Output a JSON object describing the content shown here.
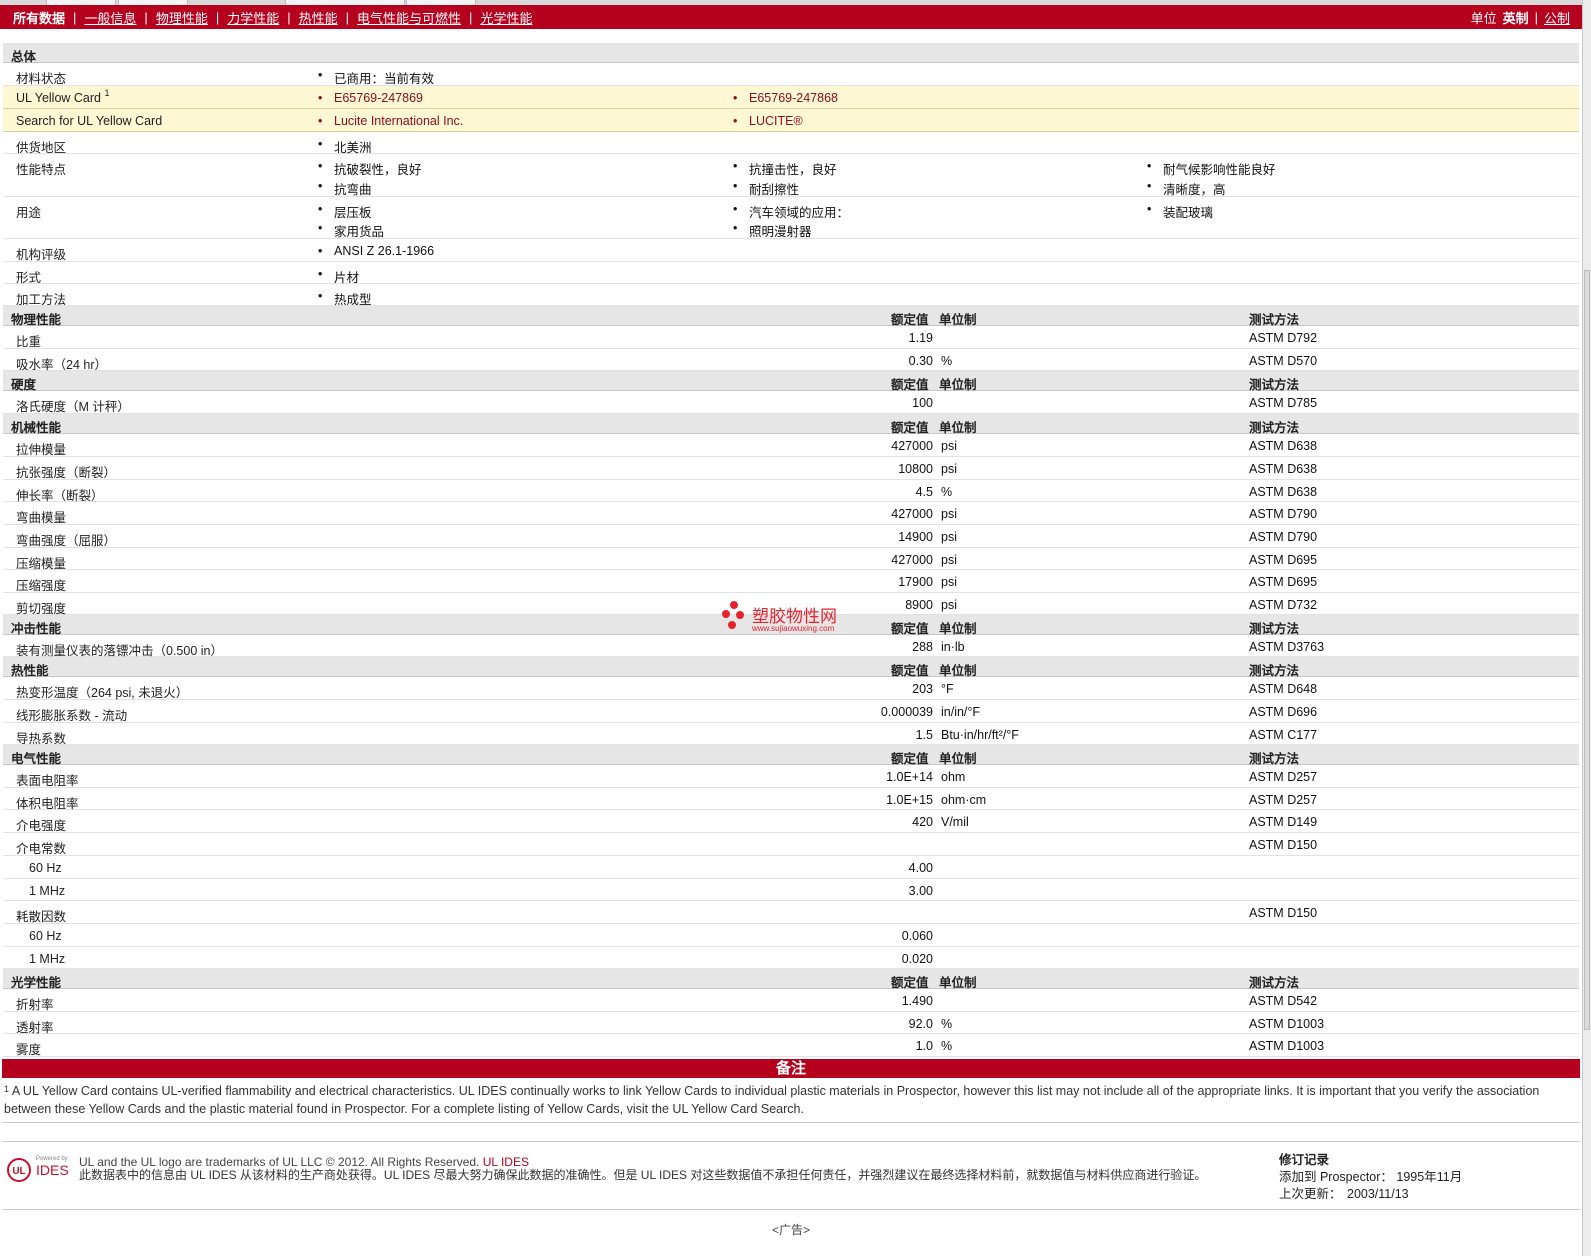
{
  "nav": {
    "items": [
      {
        "label": "所有数据",
        "active": true
      },
      {
        "label": "一般信息"
      },
      {
        "label": "物理性能"
      },
      {
        "label": "力学性能"
      },
      {
        "label": "热性能"
      },
      {
        "label": "电气性能与可燃性"
      },
      {
        "label": "光学性能"
      }
    ],
    "units_label": "单位",
    "unit_english": "英制",
    "unit_separator": "|",
    "unit_metric": "公制"
  },
  "col_headers": {
    "value": "额定值",
    "unit": "单位制",
    "method": "测试方法"
  },
  "general": {
    "title": "总体",
    "material_status": {
      "label": "材料状态",
      "values": [
        "已商用：当前有效"
      ]
    },
    "yellow_card": {
      "label": "UL Yellow Card",
      "sup": "1",
      "values": [
        "E65769-247869",
        "E65769-247868"
      ]
    },
    "search_yellow": {
      "label": "Search for UL Yellow Card",
      "values": [
        "Lucite International Inc.",
        "LUCITE®"
      ]
    },
    "supply": {
      "label": "供货地区",
      "values": [
        "北美洲"
      ]
    },
    "features": {
      "label": "性能特点",
      "values": [
        "抗破裂性，良好",
        "抗撞击性，良好",
        "耐气候影响性能良好",
        "抗弯曲",
        "耐刮擦性",
        "清晰度，高"
      ]
    },
    "uses": {
      "label": "用途",
      "values": [
        "层压板",
        "汽车领域的应用：",
        "装配玻璃",
        "家用货品",
        "照明漫射器"
      ]
    },
    "rating": {
      "label": "机构评级",
      "values": [
        "ANSI Z 26.1-1966"
      ]
    },
    "form": {
      "label": "形式",
      "values": [
        "片材"
      ]
    },
    "processing": {
      "label": "加工方法",
      "values": [
        "热成型"
      ]
    }
  },
  "physical": {
    "title": "物理性能",
    "rows": [
      {
        "label": "比重",
        "value": "1.19",
        "unit": "",
        "method": "ASTM D792"
      },
      {
        "label": "吸水率（24 hr）",
        "value": "0.30",
        "unit": "%",
        "method": "ASTM D570"
      }
    ]
  },
  "hardness": {
    "title": "硬度",
    "rows": [
      {
        "label": "洛氏硬度（M 计秤）",
        "value": "100",
        "unit": "",
        "method": "ASTM D785"
      }
    ]
  },
  "mechanical": {
    "title": "机械性能",
    "rows": [
      {
        "label": "拉伸模量",
        "value": "427000",
        "unit": "psi",
        "method": "ASTM D638"
      },
      {
        "label": "抗张强度（断裂）",
        "value": "10800",
        "unit": "psi",
        "method": "ASTM D638"
      },
      {
        "label": "伸长率（断裂）",
        "value": "4.5",
        "unit": "%",
        "method": "ASTM D638"
      },
      {
        "label": "弯曲模量",
        "value": "427000",
        "unit": "psi",
        "method": "ASTM D790"
      },
      {
        "label": "弯曲强度（屈服）",
        "value": "14900",
        "unit": "psi",
        "method": "ASTM D790"
      },
      {
        "label": "压缩模量",
        "value": "427000",
        "unit": "psi",
        "method": "ASTM D695"
      },
      {
        "label": "压缩强度",
        "value": "17900",
        "unit": "psi",
        "method": "ASTM D695"
      },
      {
        "label": "剪切强度",
        "value": "8900",
        "unit": "psi",
        "method": "ASTM D732"
      }
    ]
  },
  "impact": {
    "title": "冲击性能",
    "rows": [
      {
        "label": "装有测量仪表的落镖冲击（0.500 in）",
        "value": "288",
        "unit": "in·lb",
        "method": "ASTM D3763"
      }
    ]
  },
  "thermal": {
    "title": "热性能",
    "rows": [
      {
        "label": "热变形温度（264 psi, 未退火）",
        "value": "203",
        "unit": "°F",
        "method": "ASTM D648"
      },
      {
        "label": "线形膨胀系数 - 流动",
        "value": "0.000039",
        "unit": "in/in/°F",
        "method": "ASTM D696"
      },
      {
        "label": "导热系数",
        "value": "1.5",
        "unit": "Btu·in/hr/ft²/°F",
        "method": "ASTM C177"
      }
    ]
  },
  "electrical": {
    "title": "电气性能",
    "rows": [
      {
        "label": "表面电阻率",
        "value": "1.0E+14",
        "unit": "ohm",
        "method": "ASTM D257"
      },
      {
        "label": "体积电阻率",
        "value": "1.0E+15",
        "unit": "ohm·cm",
        "method": "ASTM D257"
      },
      {
        "label": "介电强度",
        "value": "420",
        "unit": "V/mil",
        "method": "ASTM D149"
      },
      {
        "label": "介电常数",
        "value": "",
        "unit": "",
        "method": "ASTM D150"
      },
      {
        "label": "60 Hz",
        "value": "4.00",
        "unit": "",
        "method": ""
      },
      {
        "label": "1 MHz",
        "value": "3.00",
        "unit": "",
        "method": ""
      },
      {
        "label": "耗散因数",
        "value": "",
        "unit": "",
        "method": "ASTM D150"
      },
      {
        "label": "60 Hz",
        "value": "0.060",
        "unit": "",
        "method": ""
      },
      {
        "label": "1 MHz",
        "value": "0.020",
        "unit": "",
        "method": ""
      }
    ]
  },
  "optical": {
    "title": "光学性能",
    "rows": [
      {
        "label": "折射率",
        "value": "1.490",
        "unit": "",
        "method": "ASTM D542"
      },
      {
        "label": "透射率",
        "value": "92.0",
        "unit": "%",
        "method": "ASTM D1003"
      },
      {
        "label": "雾度",
        "value": "1.0",
        "unit": "%",
        "method": "ASTM D1003"
      }
    ]
  },
  "notes": {
    "title": "备注",
    "sup": "1",
    "text": "A UL Yellow Card contains UL-verified flammability and electrical characteristics. UL IDES continually works to link Yellow Cards to individual plastic materials in Prospector, however this list may not include all of the appropriate links. It is important that you verify the association between these Yellow Cards and the plastic material found in Prospector. For a complete listing of Yellow Cards, visit the UL Yellow Card Search."
  },
  "footer": {
    "logo_powered": "Powered by",
    "logo_ul": "UL",
    "logo_ides": "IDES",
    "trademark": "UL and the UL logo are trademarks of UL LLC © 2012. All Rights Reserved.",
    "ul_ides_ref": "UL IDES",
    "disclaimer": "此数据表中的信息由  UL IDES 从该材料的生产商处获得。UL IDES 尽最大努力确保此数据的准确性。但是  UL IDES 对这些数据值不承担任何责任，并强烈建议在最终选择材料前，就数据值与材料供应商进行验证。",
    "revision_title": "修订记录",
    "added_label": "添加到  Prospector：",
    "added_value": "1995年11月",
    "updated_label": "上次更新：",
    "updated_value": "2003/11/13"
  },
  "watermark": {
    "cn": "塑胶物性网",
    "en": "www.sujiaowuxing.com"
  },
  "ad_label": "<广告>",
  "colors": {
    "brand_red": "#b5001e",
    "highlight_row": "#fdf7d4",
    "section_bg": "#e6e6e6"
  }
}
